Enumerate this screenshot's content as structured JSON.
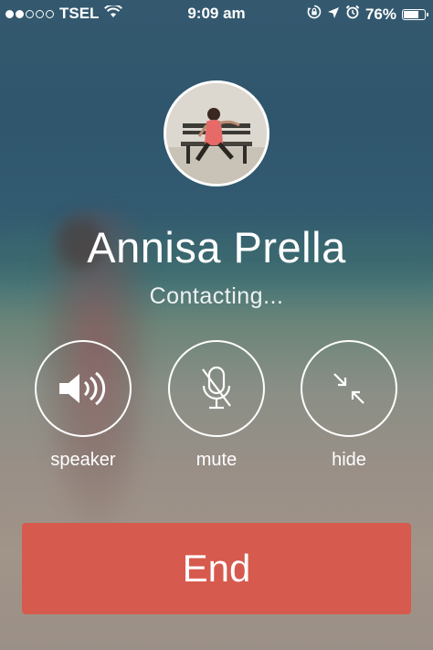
{
  "status_bar": {
    "carrier": "TSEL",
    "time": "9:09 am",
    "battery": "76%",
    "battery_level": 0.76,
    "signal_bars_filled": 2,
    "signal_bars_total": 5
  },
  "call": {
    "contact_name": "Annisa Prella",
    "status": "Contacting..."
  },
  "controls": {
    "speaker_label": "speaker",
    "mute_label": "mute",
    "hide_label": "hide"
  },
  "end_button": {
    "label": "End"
  },
  "colors": {
    "end_button": "#d65a4d",
    "text": "#ffffff"
  },
  "icons": [
    "wifi-icon",
    "orientation-lock-icon",
    "location-arrow-icon",
    "alarm-icon",
    "battery-icon",
    "speaker-icon",
    "mute-icon",
    "hide-icon"
  ]
}
